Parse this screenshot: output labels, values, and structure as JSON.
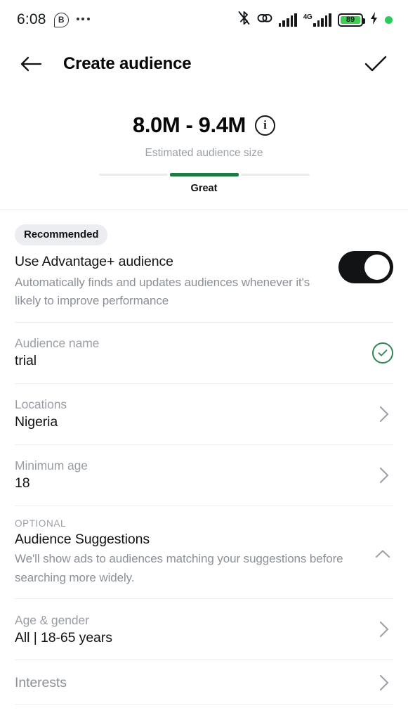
{
  "status_bar": {
    "time": "6:08",
    "app_badge_letter": "B",
    "overflow_icon": "more-horizontal-icon",
    "bluetooth_icon": "bluetooth-off-icon",
    "link_icon": "link-icon",
    "signal_icon": "signal-bars-icon",
    "network_label": "4G",
    "network_icon": "signal-bars-4g-icon",
    "battery_percent": "89",
    "battery_level": 89,
    "charging_icon": "charging-bolt-icon",
    "recording_dot_icon": "green-status-dot-icon",
    "accent_green": "#2ecb5a"
  },
  "app_bar": {
    "back_icon": "arrow-left-icon",
    "title": "Create audience",
    "confirm_icon": "checkmark-icon"
  },
  "estimate": {
    "value": "8.0M - 9.4M",
    "info_icon": "info-circle-icon",
    "info_glyph": "i",
    "subtitle": "Estimated audience size",
    "quality_label": "Great",
    "meter_segments": 3,
    "meter_active_index": 1,
    "meter_active_color": "#1e7a42",
    "meter_inactive_color": "#e9ebee"
  },
  "advantage": {
    "badge": "Recommended",
    "title": "Use Advantage+ audience",
    "description": "Automatically finds and updates audiences whenever it's likely to improve performance",
    "toggle_state": "on",
    "toggle_on_color": "#111315"
  },
  "fields": [
    {
      "name": "audience-name",
      "label": "Audience name",
      "value": "trial",
      "accessory": "check-circle-icon",
      "accessory_color": "#2f8553"
    },
    {
      "name": "locations",
      "label": "Locations",
      "value": "Nigeria",
      "accessory": "chevron-right-icon"
    },
    {
      "name": "minimum-age",
      "label": "Minimum age",
      "value": "18",
      "accessory": "chevron-right-icon"
    }
  ],
  "suggestions_section": {
    "optional_label": "OPTIONAL",
    "title": "Audience Suggestions",
    "description": "We'll show ads to audiences matching your suggestions before searching more widely.",
    "collapse_icon": "chevron-up-icon"
  },
  "suggestion_fields": [
    {
      "name": "age-and-gender",
      "label": "Age & gender",
      "value": "All | 18-65 years",
      "accessory": "chevron-right-icon"
    },
    {
      "name": "interests",
      "label": "Interests",
      "value": "",
      "accessory": "chevron-right-icon"
    }
  ]
}
